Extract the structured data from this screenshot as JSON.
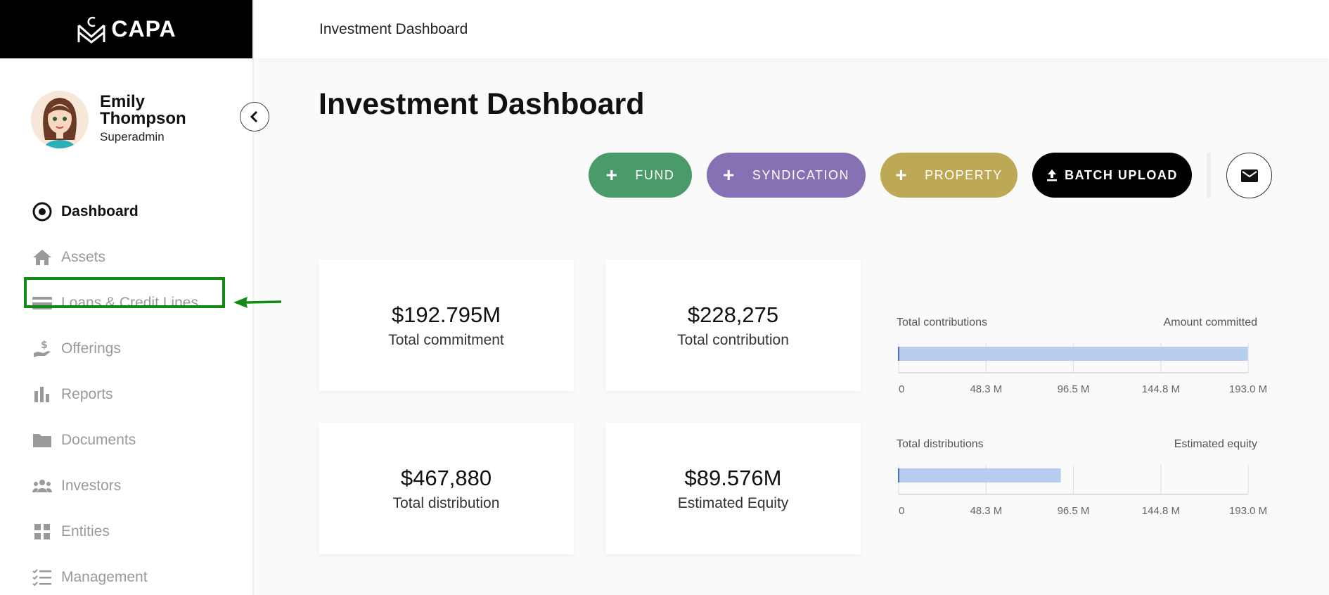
{
  "logo": {
    "text": "CAPA"
  },
  "user": {
    "name": "Emily Thompson",
    "role": "Superadmin"
  },
  "nav": [
    {
      "label": "Dashboard",
      "icon": "dashboard-icon",
      "active": true
    },
    {
      "label": "Assets",
      "icon": "home-icon"
    },
    {
      "label": "Loans & Credit Lines",
      "icon": "credit-card-icon"
    },
    {
      "label": "Offerings",
      "icon": "hand-money-icon"
    },
    {
      "label": "Reports",
      "icon": "bar-chart-icon"
    },
    {
      "label": "Documents",
      "icon": "folder-icon"
    },
    {
      "label": "Investors",
      "icon": "users-icon"
    },
    {
      "label": "Entities",
      "icon": "grid-icon"
    },
    {
      "label": "Management",
      "icon": "checklist-icon"
    }
  ],
  "topbar": {
    "breadcrumb": "Investment Dashboard"
  },
  "page": {
    "title": "Investment Dashboard"
  },
  "actions": {
    "fund": "FUND",
    "syndication": "SYNDICATION",
    "property": "PROPERTY",
    "batch_upload": "BATCH UPLOAD"
  },
  "colors": {
    "fund": "#4b9b6a",
    "syndication": "#8771b5",
    "property": "#bda955",
    "highlight": "#138a13",
    "bar": "#b7cdf0"
  },
  "cards": [
    {
      "value": "$192.795M",
      "label": "Total commitment"
    },
    {
      "value": "$228,275",
      "label": "Total contribution"
    },
    {
      "value": "$467,880",
      "label": "Total distribution"
    },
    {
      "value": "$89.576M",
      "label": "Estimated Equity"
    }
  ],
  "chart_data": [
    {
      "type": "bar",
      "left_label": "Total contributions",
      "right_label": "Amount committed",
      "value": 192.795,
      "xlim": [
        0,
        193.0
      ],
      "ticks": [
        "0",
        "48.3 M",
        "96.5 M",
        "144.8 M",
        "193.0 M"
      ],
      "tick_values": [
        0,
        48.3,
        96.5,
        144.8,
        193.0
      ],
      "grid": true
    },
    {
      "type": "bar",
      "left_label": "Total distributions",
      "right_label": "Estimated equity",
      "value": 89.576,
      "xlim": [
        0,
        193.0
      ],
      "ticks": [
        "0",
        "48.3 M",
        "96.5 M",
        "144.8 M",
        "193.0 M"
      ],
      "tick_values": [
        0,
        48.3,
        96.5,
        144.8,
        193.0
      ],
      "grid": true
    }
  ]
}
